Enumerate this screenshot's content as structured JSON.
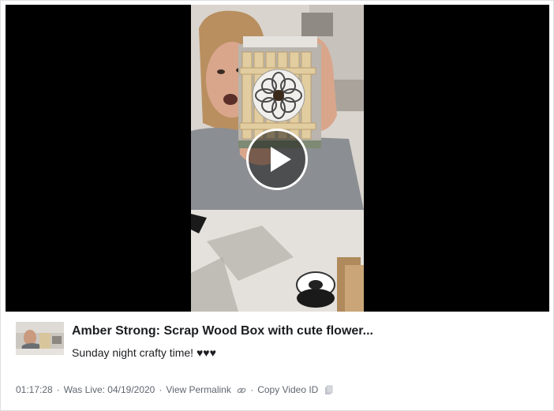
{
  "video": {
    "title": "Amber Strong: Scrap Wood Box with cute flower...",
    "description": "Sunday night crafty time! ♥♥♥",
    "duration": "01:17:28",
    "separator": "·",
    "live_label": "Was Live: 04/19/2020",
    "permalink_label": "View Permalink",
    "copy_id_label": "Copy Video ID",
    "icons": {
      "play": "play-icon",
      "permalink": "link-icon",
      "copy": "copy-icon"
    }
  },
  "colors": {
    "player_background": "#000000",
    "meta_text": "#606770",
    "title_text": "#1c1e21"
  }
}
